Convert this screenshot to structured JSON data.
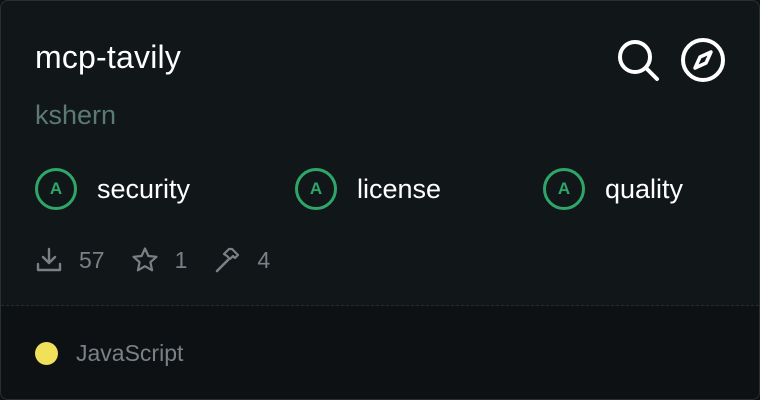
{
  "repo": {
    "name": "mcp-tavily",
    "author": "kshern"
  },
  "actions": {
    "search_icon": "search-icon",
    "explore_icon": "compass-icon"
  },
  "badges": [
    {
      "grade": "A",
      "label": "security"
    },
    {
      "grade": "A",
      "label": "license"
    },
    {
      "grade": "A",
      "label": "quality"
    }
  ],
  "stats": {
    "downloads": "57",
    "stars": "1",
    "tools": "4"
  },
  "footer": {
    "language": "JavaScript",
    "language_color": "#f1e05a"
  },
  "colors": {
    "badge_accent": "#2ea66a",
    "author": "#5a7a72",
    "background": "#111618"
  }
}
